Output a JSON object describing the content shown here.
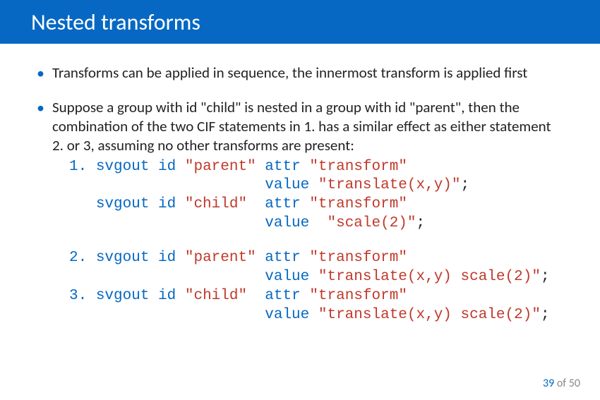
{
  "title": "Nested  transforms",
  "bullets": [
    "Transforms can be applied in sequence, the innermost transform is applied first",
    "Suppose a group with id \"child\" is nested in a group with id \"parent\", then the combination of the two CIF statements in 1. has a similar effect as either statement 2. or 3, assuming no other transforms are present:"
  ],
  "code1": {
    "n1": "1.",
    "l1a": "svgout id",
    "l1b": "\"parent\"",
    "l1c": "attr",
    "l1d": "\"transform\"",
    "l2a": "value",
    "l2b": "\"translate(x,y)\"",
    "l2c": ";",
    "l3a": "svgout id",
    "l3b": "\"child\"",
    "l3c": "attr",
    "l3d": "\"transform\"",
    "l4a": "value",
    "l4b": "\"scale(2)\"",
    "l4c": ";"
  },
  "code2": {
    "n2": "2.",
    "l1a": "svgout id",
    "l1b": "\"parent\"",
    "l1c": "attr",
    "l1d": "\"transform\"",
    "l2a": "value",
    "l2b": "\"translate(x,y) scale(2)\"",
    "l2c": ";",
    "n3": "3.",
    "l3a": "svgout id",
    "l3b": "\"child\"",
    "l3c": "attr",
    "l3d": "\"transform\"",
    "l4a": "value",
    "l4b": "\"translate(x,y) scale(2)\"",
    "l4c": ";"
  },
  "footer": {
    "page": "39",
    "of": "of",
    "total": "50"
  }
}
